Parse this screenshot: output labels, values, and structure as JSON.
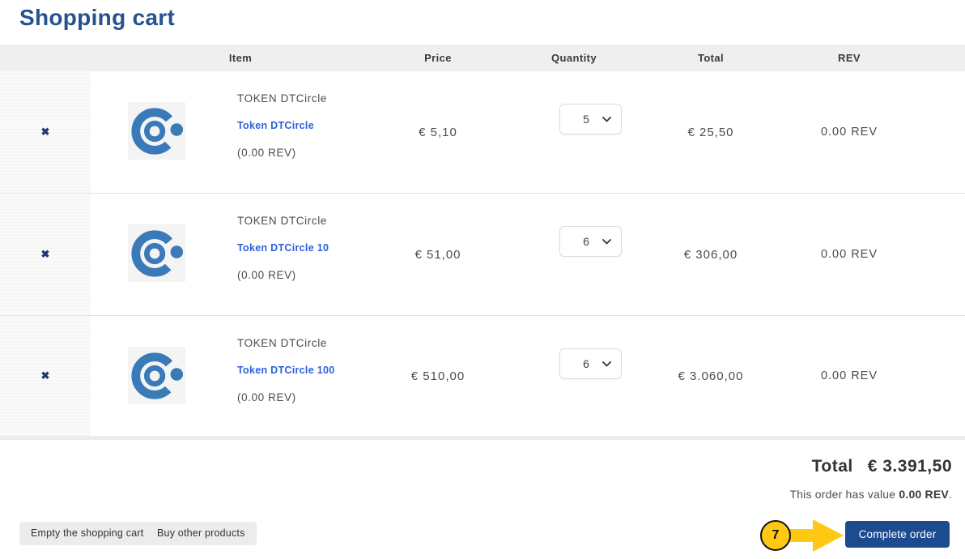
{
  "page": {
    "title": "Shopping cart"
  },
  "table": {
    "headers": {
      "item": "Item",
      "price": "Price",
      "quantity": "Quantity",
      "total": "Total",
      "rev": "REV"
    },
    "rows": [
      {
        "name": "TOKEN DTCircle",
        "link": "Token DTCircle",
        "rev_note": "(0.00 REV)",
        "price": "€ 5,10",
        "quantity": "5",
        "total": "€ 25,50",
        "rev": "0.00 REV"
      },
      {
        "name": "TOKEN DTCircle",
        "link": "Token DTCircle 10",
        "rev_note": "(0.00 REV)",
        "price": "€ 51,00",
        "quantity": "6",
        "total": "€ 306,00",
        "rev": "0.00 REV"
      },
      {
        "name": "TOKEN DTCircle",
        "link": "Token DTCircle 100",
        "rev_note": "(0.00 REV)",
        "price": "€ 510,00",
        "quantity": "6",
        "total": "€ 3.060,00",
        "rev": "0.00 REV"
      }
    ]
  },
  "summary": {
    "total_label": "Total",
    "total_value": "€ 3.391,50",
    "note_prefix": "This order has value ",
    "note_value": "0.00 REV",
    "note_suffix": "."
  },
  "actions": {
    "empty_cart": "Empty the shopping cart",
    "buy_other": "Buy other products",
    "complete_order": "Complete order"
  },
  "annotation": {
    "step_number": "7"
  },
  "icons": {
    "remove": "✖"
  },
  "colors": {
    "title_blue": "#27518f",
    "link_blue": "#2c60de",
    "logo_blue": "#3a7ab8",
    "button_blue": "#1c4b8f",
    "annotation_yellow": "#ffc913",
    "header_gray": "#efefef"
  }
}
